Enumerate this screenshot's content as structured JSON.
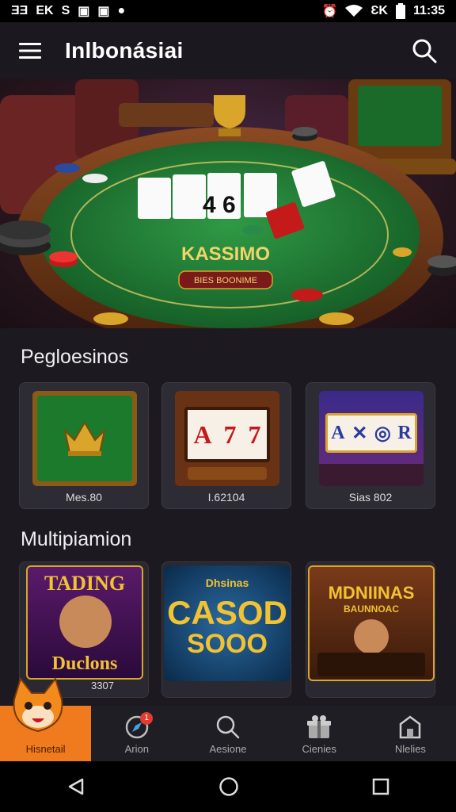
{
  "status_bar": {
    "left_icons": [
      "ƎƎ",
      "EK",
      "S",
      "▣",
      "▣",
      "●"
    ],
    "signal": "ƐK",
    "time": "11:35"
  },
  "app_bar": {
    "title": "Inlbonásiai"
  },
  "hero": {
    "table_text": "KASSIMO",
    "plate_text": "BIES BOONIME",
    "card_text": "4   6"
  },
  "section1": {
    "title": "Pegloesinos",
    "cards": [
      {
        "label": "Mes.80",
        "icon": "crown-emblem-icon"
      },
      {
        "label": "I.62104",
        "icon": "slot-machine-icon"
      },
      {
        "label": "Sias 802",
        "icon": "slot-reels-icon"
      }
    ]
  },
  "section2": {
    "title": "Multipiamion",
    "cards": [
      {
        "line1": "TADING",
        "line2": "Duclons",
        "label": "3307"
      },
      {
        "line1": "Dhsinas",
        "line2": "CASOD",
        "line3": "SOOO"
      },
      {
        "line1": "MDNIINAS",
        "line2": "BAUNNOAC"
      }
    ]
  },
  "bottom_nav": [
    {
      "label": "Hisnetail",
      "icon": "fox-mascot-icon",
      "active": true
    },
    {
      "label": "Arion",
      "icon": "compass-icon",
      "badge": "1"
    },
    {
      "label": "Aesione",
      "icon": "search-icon"
    },
    {
      "label": "Cienies",
      "icon": "gift-icon"
    },
    {
      "label": "Nlelies",
      "icon": "shop-icon"
    }
  ],
  "colors": {
    "accent": "#f07a1e",
    "felt": "#1f7a35",
    "gold": "#d9a52a",
    "badge": "#e33b2f"
  }
}
